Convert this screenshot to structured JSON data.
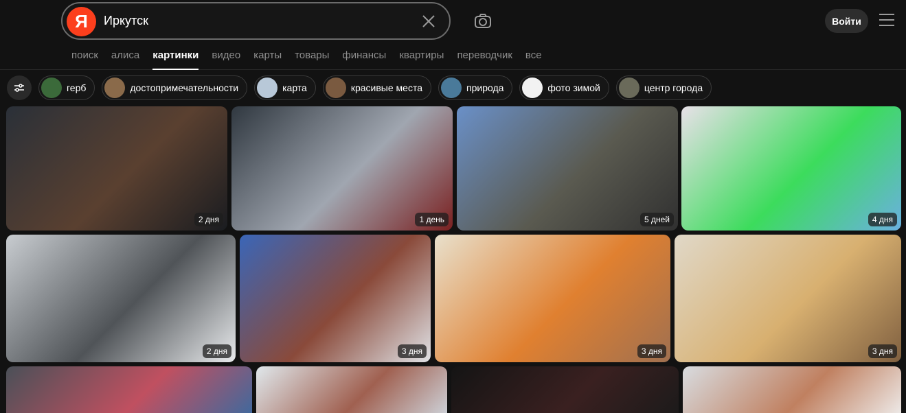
{
  "search": {
    "query": "Иркутск",
    "logo": "Я"
  },
  "header": {
    "login_label": "Войти"
  },
  "nav": {
    "tabs": [
      "поиск",
      "алиса",
      "картинки",
      "видео",
      "карты",
      "товары",
      "финансы",
      "квартиры",
      "переводчик",
      "все"
    ],
    "active_index": 2
  },
  "filters": {
    "chips": [
      {
        "label": "герб",
        "color": "#3b6a3a"
      },
      {
        "label": "достопримечательности",
        "color": "#8a6a4a"
      },
      {
        "label": "карта",
        "color": "#b8c8d8"
      },
      {
        "label": "красивые места",
        "color": "#7a5a40"
      },
      {
        "label": "природа",
        "color": "#4a7a9a"
      },
      {
        "label": "фото зимой",
        "color": "#f2f2f2"
      },
      {
        "label": "центр города",
        "color": "#6a6a5a"
      }
    ]
  },
  "results": [
    {
      "badge": "2 дня",
      "colors": [
        "#2a3038",
        "#5a4030",
        "#1a1c20"
      ]
    },
    {
      "badge": "1 день",
      "colors": [
        "#303840",
        "#a0a6b0",
        "#7a2020"
      ]
    },
    {
      "badge": "5 дней",
      "colors": [
        "#6a90c8",
        "#5a5a50",
        "#303030"
      ]
    },
    {
      "badge": "4 дня",
      "colors": [
        "#e8e0e8",
        "#3cdc5c",
        "#6ab0e0"
      ]
    },
    {
      "badge": "2 дня",
      "colors": [
        "#c8ccd0",
        "#505458",
        "#e8eaec"
      ]
    },
    {
      "badge": "3 дня",
      "colors": [
        "#3a66b8",
        "#8a4a3a",
        "#e0e2e6"
      ]
    },
    {
      "badge": "3 дня",
      "colors": [
        "#e8e0cc",
        "#e08030",
        "#a07050"
      ]
    },
    {
      "badge": "3 дня",
      "colors": [
        "#e0d8c8",
        "#d8b070",
        "#806040"
      ]
    },
    {
      "badge": "",
      "colors": [
        "#4a5058",
        "#c05060",
        "#3a6aa0"
      ]
    },
    {
      "badge": "",
      "colors": [
        "#e0e8ec",
        "#a06050",
        "#d0d8e0"
      ]
    },
    {
      "badge": "",
      "colors": [
        "#141414",
        "#3a2020",
        "#1a1a1a"
      ]
    },
    {
      "badge": "",
      "colors": [
        "#d8dce0",
        "#c08060",
        "#f0f0f0"
      ]
    }
  ]
}
